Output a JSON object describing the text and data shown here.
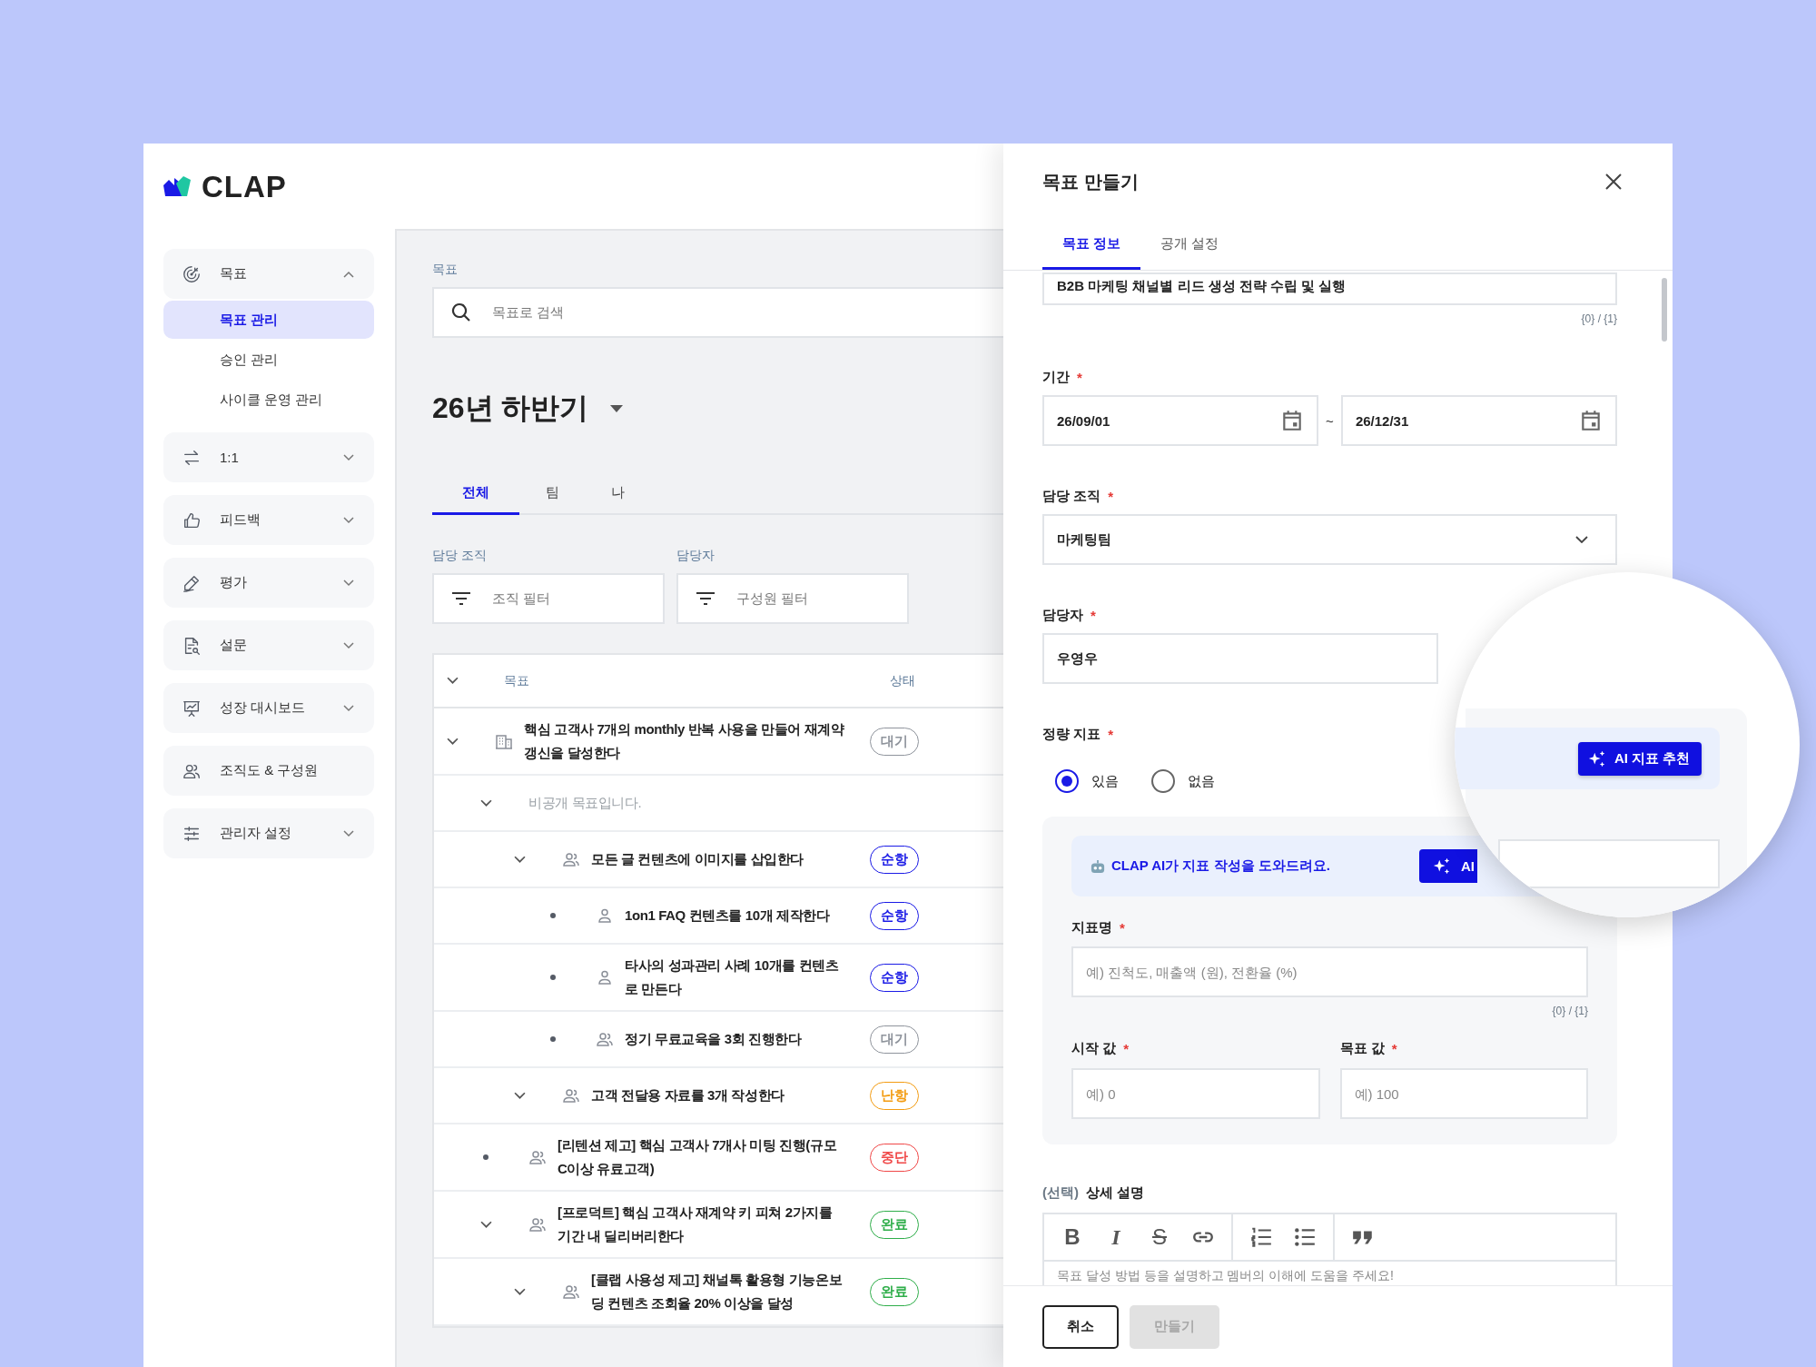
{
  "app": {
    "logo": "CLAP"
  },
  "sidebar": {
    "items": [
      {
        "kind": "group",
        "label": "목표",
        "expanded": true,
        "children": [
          {
            "label": "목표 관리",
            "selected": true
          },
          {
            "label": "승인 관리",
            "selected": false
          },
          {
            "label": "사이클 운영 관리",
            "selected": false
          }
        ]
      },
      {
        "kind": "group",
        "label": "1:1",
        "expanded": false
      },
      {
        "kind": "group",
        "label": "피드백",
        "expanded": false
      },
      {
        "kind": "group",
        "label": "평가",
        "expanded": false
      },
      {
        "kind": "group",
        "label": "설문",
        "expanded": false
      },
      {
        "kind": "group",
        "label": "성장 대시보드",
        "expanded": false
      },
      {
        "kind": "link",
        "label": "조직도 & 구성원"
      },
      {
        "kind": "group",
        "label": "관리자 설정",
        "expanded": false
      }
    ]
  },
  "main": {
    "search": {
      "label": "목표",
      "placeholder": "목표로 검색"
    },
    "period": "26년 하반기",
    "tabs": [
      {
        "label": "전체",
        "selected": true
      },
      {
        "label": "팀",
        "selected": false
      },
      {
        "label": "나",
        "selected": false
      }
    ],
    "filters": [
      {
        "label": "담당 조직",
        "placeholder": "조직 필터"
      },
      {
        "label": "담당자",
        "placeholder": "구성원 필터"
      }
    ],
    "table": {
      "columns": [
        "목표",
        "상태"
      ],
      "rows": [
        {
          "kind": "org",
          "text": "핵심 고객사 7개의 monthly 반복 사용을 만들어 재계약 갱신을 달성한다",
          "expanded": true,
          "status": {
            "label": "대기",
            "color": "#8f949c"
          },
          "children": [
            {
              "kind": "private",
              "text": "비공개 목표입니다.",
              "expanded": true,
              "children": [
                {
                  "kind": "team",
                  "text": "모든 글 컨텐츠에 이미지를 삽입한다",
                  "expanded": true,
                  "status": {
                    "label": "순항",
                    "color": "#1a1ae6"
                  },
                  "children": [
                    {
                      "kind": "person",
                      "text": "1on1 FAQ 컨텐츠를 10개 제작한다",
                      "expanded": false,
                      "status": {
                        "label": "순항",
                        "color": "#1a1ae6"
                      }
                    },
                    {
                      "kind": "person",
                      "text": "타사의 성과관리 사례 10개를 컨텐츠로 만든다",
                      "expanded": false,
                      "status": {
                        "label": "순항",
                        "color": "#1a1ae6"
                      }
                    },
                    {
                      "kind": "team",
                      "text": "정기 무료교육을 3회 진행한다",
                      "expanded": false,
                      "status": {
                        "label": "대기",
                        "color": "#8f949c"
                      }
                    }
                  ]
                },
                {
                  "kind": "team",
                  "text": "고객 전달용 자료를 3개 작성한다",
                  "expanded": true,
                  "status": {
                    "label": "난항",
                    "color": "#f39c12"
                  }
                }
              ]
            },
            {
              "kind": "team",
              "text": "[리텐션 제고] 핵심 고객사 7개사 미팅 진행(규모 C이상 유료고객)",
              "expanded": false,
              "status": {
                "label": "중단",
                "color": "#f04848"
              }
            },
            {
              "kind": "team",
              "text": "[프로덕트] 핵심 고객사 재계약 키 피쳐 2가지를 기간 내 딜리버리한다",
              "expanded": true,
              "status": {
                "label": "완료",
                "color": "#2fae4a"
              },
              "children": [
                {
                  "kind": "team",
                  "text": "[클랩 사용성 제고] 채널톡 활용형 기능온보딩 컨텐츠 조회율 20% 이상을 달성",
                  "expanded": true,
                  "status": {
                    "label": "완료",
                    "color": "#2fae4a"
                  }
                }
              ]
            }
          ]
        }
      ]
    }
  },
  "drawer": {
    "title": "목표 만들기",
    "tabs": [
      {
        "label": "목표 정보",
        "selected": true
      },
      {
        "label": "공개 설정",
        "selected": false
      }
    ],
    "name_field": {
      "value": "B2B 마케팅 채널별 리드 생성 전략 수립 및 실행",
      "counter": "{0} / {1}"
    },
    "period": {
      "label": "기간",
      "required_mark": "*",
      "start": "26/09/01",
      "separator": "~",
      "end": "26/12/31"
    },
    "org": {
      "label": "담당 조직",
      "required_mark": "*",
      "value": "마케팅팀"
    },
    "owner": {
      "label": "담당자",
      "required_mark": "*",
      "value": "우영우"
    },
    "metric": {
      "label": "정량 지표",
      "required_mark": "*",
      "options": [
        {
          "label": "있음",
          "selected": true
        },
        {
          "label": "없음",
          "selected": false
        }
      ],
      "ai_banner": {
        "text": "CLAP AI가 지표 작성을 도와드려요.",
        "button": "AI"
      },
      "name": {
        "label": "지표명",
        "required_mark": "*",
        "placeholder": "예) 진척도, 매출액 (원), 전환율 (%)",
        "counter": "{0} / {1}"
      },
      "start": {
        "label": "시작 값",
        "required_mark": "*",
        "placeholder": "예) 0"
      },
      "target": {
        "label": "목표 값",
        "required_mark": "*",
        "placeholder": "예) 100"
      }
    },
    "description": {
      "optional_tag": "(선택)",
      "label": "상세 설명",
      "toolbar": [
        [
          {
            "kind": "bold",
            "label": "B"
          },
          {
            "kind": "italic",
            "label": "I"
          },
          {
            "kind": "strike",
            "label": "S"
          },
          {
            "kind": "link"
          }
        ],
        [
          {
            "kind": "ordered-list"
          },
          {
            "kind": "bullet-list"
          }
        ],
        [
          {
            "kind": "quote"
          }
        ]
      ],
      "placeholder": "목표 달성 방법 등을 설명하고 멤버의 이해에 도움을 주세요!"
    },
    "footer": {
      "cancel": "취소",
      "submit": {
        "label": "만들기",
        "disabled": true
      }
    }
  },
  "magnifier": {
    "button": "AI 지표 추천"
  }
}
